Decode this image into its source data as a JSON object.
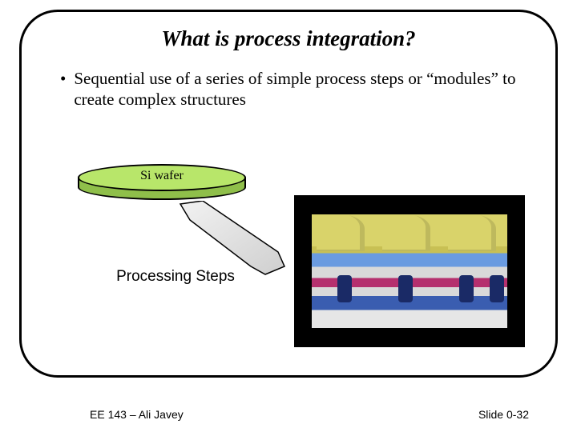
{
  "title": "What is process integration?",
  "bullet": "Sequential use of a series of simple process steps or “modules” to create complex structures",
  "wafer_label": "Si wafer",
  "processing_label": "Processing Steps",
  "footer_left": "EE 143 – Ali Javey",
  "footer_right": "Slide 0-32"
}
